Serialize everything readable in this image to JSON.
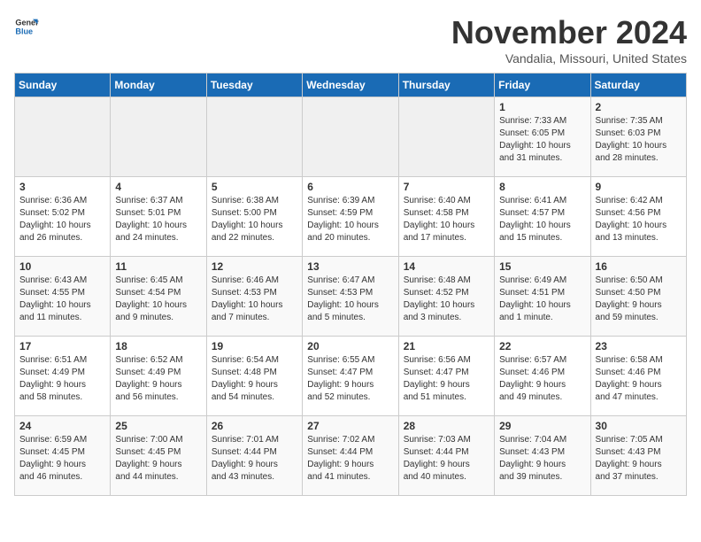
{
  "logo": {
    "general": "General",
    "blue": "Blue"
  },
  "header": {
    "month_title": "November 2024",
    "location": "Vandalia, Missouri, United States"
  },
  "weekdays": [
    "Sunday",
    "Monday",
    "Tuesday",
    "Wednesday",
    "Thursday",
    "Friday",
    "Saturday"
  ],
  "weeks": [
    [
      {
        "day": "",
        "detail": ""
      },
      {
        "day": "",
        "detail": ""
      },
      {
        "day": "",
        "detail": ""
      },
      {
        "day": "",
        "detail": ""
      },
      {
        "day": "",
        "detail": ""
      },
      {
        "day": "1",
        "detail": "Sunrise: 7:33 AM\nSunset: 6:05 PM\nDaylight: 10 hours\nand 31 minutes."
      },
      {
        "day": "2",
        "detail": "Sunrise: 7:35 AM\nSunset: 6:03 PM\nDaylight: 10 hours\nand 28 minutes."
      }
    ],
    [
      {
        "day": "3",
        "detail": "Sunrise: 6:36 AM\nSunset: 5:02 PM\nDaylight: 10 hours\nand 26 minutes."
      },
      {
        "day": "4",
        "detail": "Sunrise: 6:37 AM\nSunset: 5:01 PM\nDaylight: 10 hours\nand 24 minutes."
      },
      {
        "day": "5",
        "detail": "Sunrise: 6:38 AM\nSunset: 5:00 PM\nDaylight: 10 hours\nand 22 minutes."
      },
      {
        "day": "6",
        "detail": "Sunrise: 6:39 AM\nSunset: 4:59 PM\nDaylight: 10 hours\nand 20 minutes."
      },
      {
        "day": "7",
        "detail": "Sunrise: 6:40 AM\nSunset: 4:58 PM\nDaylight: 10 hours\nand 17 minutes."
      },
      {
        "day": "8",
        "detail": "Sunrise: 6:41 AM\nSunset: 4:57 PM\nDaylight: 10 hours\nand 15 minutes."
      },
      {
        "day": "9",
        "detail": "Sunrise: 6:42 AM\nSunset: 4:56 PM\nDaylight: 10 hours\nand 13 minutes."
      }
    ],
    [
      {
        "day": "10",
        "detail": "Sunrise: 6:43 AM\nSunset: 4:55 PM\nDaylight: 10 hours\nand 11 minutes."
      },
      {
        "day": "11",
        "detail": "Sunrise: 6:45 AM\nSunset: 4:54 PM\nDaylight: 10 hours\nand 9 minutes."
      },
      {
        "day": "12",
        "detail": "Sunrise: 6:46 AM\nSunset: 4:53 PM\nDaylight: 10 hours\nand 7 minutes."
      },
      {
        "day": "13",
        "detail": "Sunrise: 6:47 AM\nSunset: 4:53 PM\nDaylight: 10 hours\nand 5 minutes."
      },
      {
        "day": "14",
        "detail": "Sunrise: 6:48 AM\nSunset: 4:52 PM\nDaylight: 10 hours\nand 3 minutes."
      },
      {
        "day": "15",
        "detail": "Sunrise: 6:49 AM\nSunset: 4:51 PM\nDaylight: 10 hours\nand 1 minute."
      },
      {
        "day": "16",
        "detail": "Sunrise: 6:50 AM\nSunset: 4:50 PM\nDaylight: 9 hours\nand 59 minutes."
      }
    ],
    [
      {
        "day": "17",
        "detail": "Sunrise: 6:51 AM\nSunset: 4:49 PM\nDaylight: 9 hours\nand 58 minutes."
      },
      {
        "day": "18",
        "detail": "Sunrise: 6:52 AM\nSunset: 4:49 PM\nDaylight: 9 hours\nand 56 minutes."
      },
      {
        "day": "19",
        "detail": "Sunrise: 6:54 AM\nSunset: 4:48 PM\nDaylight: 9 hours\nand 54 minutes."
      },
      {
        "day": "20",
        "detail": "Sunrise: 6:55 AM\nSunset: 4:47 PM\nDaylight: 9 hours\nand 52 minutes."
      },
      {
        "day": "21",
        "detail": "Sunrise: 6:56 AM\nSunset: 4:47 PM\nDaylight: 9 hours\nand 51 minutes."
      },
      {
        "day": "22",
        "detail": "Sunrise: 6:57 AM\nSunset: 4:46 PM\nDaylight: 9 hours\nand 49 minutes."
      },
      {
        "day": "23",
        "detail": "Sunrise: 6:58 AM\nSunset: 4:46 PM\nDaylight: 9 hours\nand 47 minutes."
      }
    ],
    [
      {
        "day": "24",
        "detail": "Sunrise: 6:59 AM\nSunset: 4:45 PM\nDaylight: 9 hours\nand 46 minutes."
      },
      {
        "day": "25",
        "detail": "Sunrise: 7:00 AM\nSunset: 4:45 PM\nDaylight: 9 hours\nand 44 minutes."
      },
      {
        "day": "26",
        "detail": "Sunrise: 7:01 AM\nSunset: 4:44 PM\nDaylight: 9 hours\nand 43 minutes."
      },
      {
        "day": "27",
        "detail": "Sunrise: 7:02 AM\nSunset: 4:44 PM\nDaylight: 9 hours\nand 41 minutes."
      },
      {
        "day": "28",
        "detail": "Sunrise: 7:03 AM\nSunset: 4:44 PM\nDaylight: 9 hours\nand 40 minutes."
      },
      {
        "day": "29",
        "detail": "Sunrise: 7:04 AM\nSunset: 4:43 PM\nDaylight: 9 hours\nand 39 minutes."
      },
      {
        "day": "30",
        "detail": "Sunrise: 7:05 AM\nSunset: 4:43 PM\nDaylight: 9 hours\nand 37 minutes."
      }
    ]
  ]
}
